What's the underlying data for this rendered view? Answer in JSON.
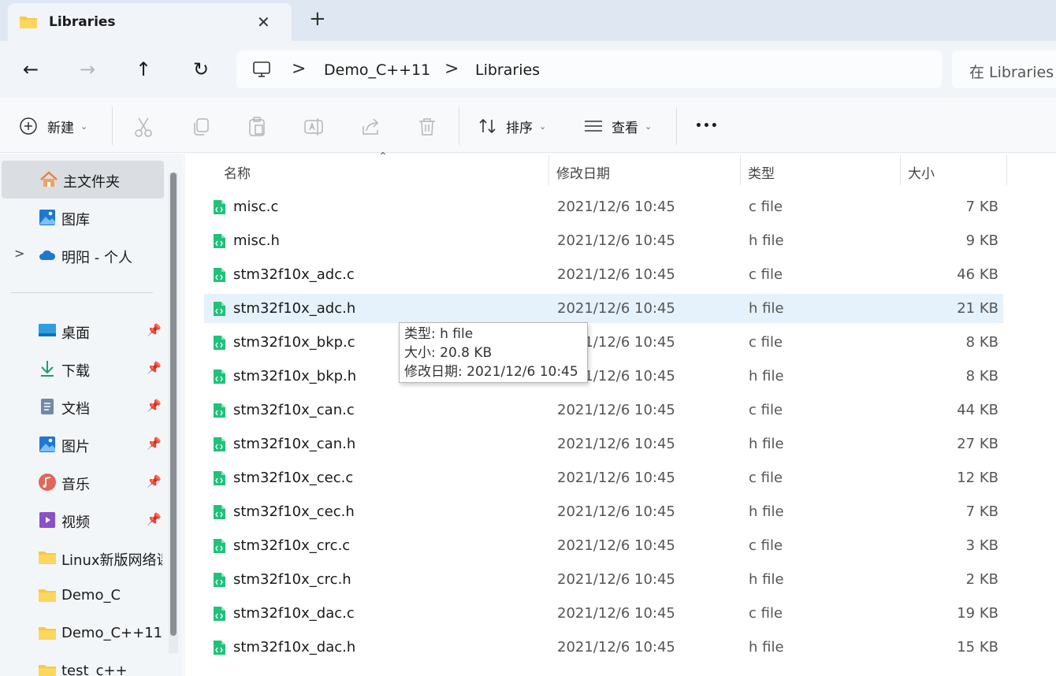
{
  "tab": {
    "title": "Libraries",
    "close_glyph": "✕",
    "new_glyph": "+"
  },
  "nav": {
    "back_glyph": "←",
    "forward_glyph": "→",
    "up_glyph": "↑",
    "refresh_glyph": "↻",
    "breadcrumb": [
      "Demo_C++11",
      "Libraries"
    ],
    "breadcrumb_sep": ">",
    "search_placeholder": "在 Libraries 中搜索"
  },
  "toolbar": {
    "new_label": "新建",
    "sort_label": "排序",
    "view_label": "查看",
    "more_glyph": "•••",
    "chevron": "⌄"
  },
  "sidebar": {
    "items": [
      {
        "label": "主文件夹",
        "icon": "home-icon",
        "active": true
      },
      {
        "label": "图库",
        "icon": "gallery-icon"
      },
      {
        "label": "明阳 - 个人",
        "icon": "onedrive-icon",
        "expandable": true
      },
      {
        "label": "桌面",
        "icon": "desktop-icon",
        "pinned": true
      },
      {
        "label": "下载",
        "icon": "download-icon",
        "pinned": true
      },
      {
        "label": "文档",
        "icon": "document-icon",
        "pinned": true
      },
      {
        "label": "图片",
        "icon": "pictures-icon",
        "pinned": true
      },
      {
        "label": "音乐",
        "icon": "music-icon",
        "pinned": true
      },
      {
        "label": "视频",
        "icon": "video-icon",
        "pinned": true
      },
      {
        "label": "Linux新版网络课",
        "icon": "folder-icon"
      },
      {
        "label": "Demo_C",
        "icon": "folder-icon"
      },
      {
        "label": "Demo_C++11",
        "icon": "folder-icon"
      },
      {
        "label": "test_c++",
        "icon": "folder-icon"
      }
    ],
    "expander_glyph": ">",
    "pin_glyph": "📌"
  },
  "columns": {
    "name": "名称",
    "date": "修改日期",
    "type": "类型",
    "size": "大小"
  },
  "files": [
    {
      "name": "misc.c",
      "date": "2021/12/6 10:45",
      "type": "c file",
      "size": "7 KB"
    },
    {
      "name": "misc.h",
      "date": "2021/12/6 10:45",
      "type": "h file",
      "size": "9 KB"
    },
    {
      "name": "stm32f10x_adc.c",
      "date": "2021/12/6 10:45",
      "type": "c file",
      "size": "46 KB"
    },
    {
      "name": "stm32f10x_adc.h",
      "date": "2021/12/6 10:45",
      "type": "h file",
      "size": "21 KB"
    },
    {
      "name": "stm32f10x_bkp.c",
      "date": "2021/12/6 10:45",
      "type": "c file",
      "size": "8 KB"
    },
    {
      "name": "stm32f10x_bkp.h",
      "date": "2021/12/6 10:45",
      "type": "h file",
      "size": "8 KB"
    },
    {
      "name": "stm32f10x_can.c",
      "date": "2021/12/6 10:45",
      "type": "c file",
      "size": "44 KB"
    },
    {
      "name": "stm32f10x_can.h",
      "date": "2021/12/6 10:45",
      "type": "h file",
      "size": "27 KB"
    },
    {
      "name": "stm32f10x_cec.c",
      "date": "2021/12/6 10:45",
      "type": "c file",
      "size": "12 KB"
    },
    {
      "name": "stm32f10x_cec.h",
      "date": "2021/12/6 10:45",
      "type": "h file",
      "size": "7 KB"
    },
    {
      "name": "stm32f10x_crc.c",
      "date": "2021/12/6 10:45",
      "type": "c file",
      "size": "3 KB"
    },
    {
      "name": "stm32f10x_crc.h",
      "date": "2021/12/6 10:45",
      "type": "h file",
      "size": "2 KB"
    },
    {
      "name": "stm32f10x_dac.c",
      "date": "2021/12/6 10:45",
      "type": "c file",
      "size": "19 KB"
    },
    {
      "name": "stm32f10x_dac.h",
      "date": "2021/12/6 10:45",
      "type": "h file",
      "size": "15 KB"
    }
  ],
  "tooltip": {
    "type_line": "类型: h file",
    "size_line": "大小: 20.8 KB",
    "date_line": "修改日期: 2021/12/6 10:45"
  },
  "colors": {
    "accent": "#0078d4",
    "file_icon": "#21c17a",
    "hover_row": "#e5f1fb",
    "folder": "#f7c948"
  }
}
